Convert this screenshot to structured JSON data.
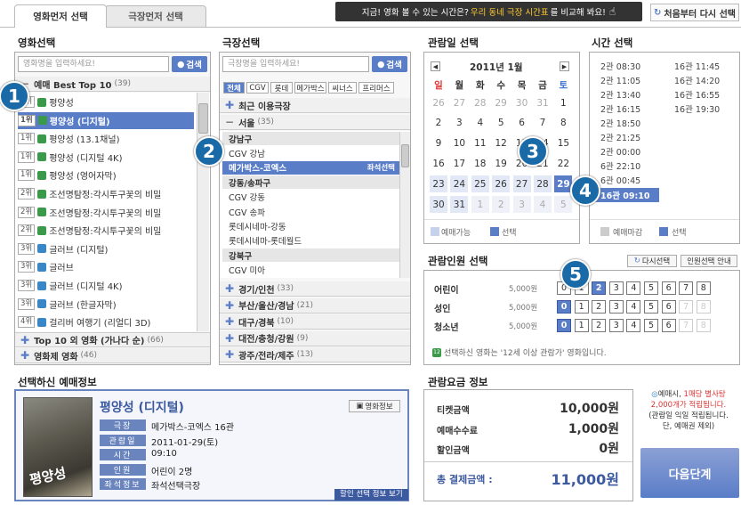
{
  "tabs": {
    "movie_first": "영화먼저 선택",
    "theater_first": "극장먼저 선택"
  },
  "promo": {
    "part1": "지금! 영화 볼 수 있는 시간은?",
    "highlight": "우리 동네 극장 시간표",
    "part2": "를 비교해 봐요!"
  },
  "reset_label": "처음부터 다시 선택",
  "movie": {
    "title": "영화선택",
    "search_placeholder": "영화명을 입력하세요!",
    "search_btn": "검색",
    "group_top": "예매 Best Top 10",
    "group_top_count": "(39)",
    "items": [
      {
        "rank": "1위",
        "name": "평양성"
      },
      {
        "rank": "1위",
        "name": "평양성 (디지털)"
      },
      {
        "rank": "1위",
        "name": "평양성 (13.1채널)"
      },
      {
        "rank": "1위",
        "name": "평양성 (디지털 4K)"
      },
      {
        "rank": "1위",
        "name": "평양성 (영어자막)"
      },
      {
        "rank": "2위",
        "name": "조선명탐정:각시투구꽃의 비밀"
      },
      {
        "rank": "2위",
        "name": "조선명탐정:각시투구꽃의 비밀"
      },
      {
        "rank": "2위",
        "name": "조선명탐정:각시투구꽃의 비밀"
      },
      {
        "rank": "3위",
        "name": "글러브 (디지털)"
      },
      {
        "rank": "3위",
        "name": "글러브"
      },
      {
        "rank": "3위",
        "name": "글러브 (디지털 4K)"
      },
      {
        "rank": "3위",
        "name": "글러브 (한글자막)"
      },
      {
        "rank": "4위",
        "name": "걸리버 여행기 (리얼디 3D)"
      }
    ],
    "group_other": "Top 10 외 영화 (가나다 순)",
    "group_other_count": "(66)",
    "group_festival": "영화제 영화",
    "group_festival_count": "(46)"
  },
  "theater": {
    "title": "극장선택",
    "search_placeholder": "극장명을 입력하세요!",
    "search_btn": "검색",
    "chains": [
      "전체",
      "CGV",
      "롯데",
      "메가박스",
      "씨너스",
      "프리머스"
    ],
    "recent": "최근 이용극장",
    "seoul": "서울",
    "seoul_count": "(35)",
    "rows": [
      {
        "text": "강남구",
        "type": "sub"
      },
      {
        "text": "CGV 강남",
        "type": "item"
      },
      {
        "text": "메가박스-코엑스",
        "type": "sel",
        "extra": "좌석선택"
      },
      {
        "text": "강동/송파구",
        "type": "sub"
      },
      {
        "text": "CGV 강동",
        "type": "item"
      },
      {
        "text": "CGV 송파",
        "type": "item"
      },
      {
        "text": "롯데시네마-강동",
        "type": "item"
      },
      {
        "text": "롯데시네마-롯데월드",
        "type": "item"
      },
      {
        "text": "강북구",
        "type": "sub"
      },
      {
        "text": "CGV 미아",
        "type": "item"
      }
    ],
    "regions": [
      {
        "name": "경기/인천",
        "count": "(33)"
      },
      {
        "name": "부산/울산/경남",
        "count": "(21)"
      },
      {
        "name": "대구/경북",
        "count": "(10)"
      },
      {
        "name": "대전/충청/강원",
        "count": "(9)"
      },
      {
        "name": "광주/전라/제주",
        "count": "(13)"
      }
    ]
  },
  "calendar": {
    "title": "관람일 선택",
    "month": "2011년 1월",
    "weekdays": [
      "일",
      "월",
      "화",
      "수",
      "목",
      "금",
      "토"
    ],
    "weeks": [
      [
        "26",
        "27",
        "28",
        "29",
        "30",
        "31",
        "1"
      ],
      [
        "2",
        "3",
        "4",
        "5",
        "6",
        "7",
        "8"
      ],
      [
        "9",
        "10",
        "11",
        "12",
        "13",
        "14",
        "15"
      ],
      [
        "16",
        "17",
        "18",
        "19",
        "20",
        "21",
        "22"
      ],
      [
        "23",
        "24",
        "25",
        "26",
        "27",
        "28",
        "29"
      ],
      [
        "30",
        "31",
        "1",
        "2",
        "3",
        "4",
        "5"
      ]
    ],
    "legend_available": "예매가능",
    "legend_selected": "선택"
  },
  "time": {
    "title": "시간 선택",
    "col1": [
      "2관 08:30",
      "2관 11:05",
      "2관 13:40",
      "2관 16:15",
      "2관 18:50",
      "2관 21:25",
      "2관 00:00",
      "6관 22:10",
      "6관 00:45",
      "16관 09:10"
    ],
    "col2": [
      "16관 11:45",
      "16관 14:20",
      "16관 16:55",
      "16관 19:30"
    ],
    "legend_closed": "예매마감",
    "legend_selected": "선택"
  },
  "people": {
    "title": "관람인원 선택",
    "reselect_btn": "다시선택",
    "guide_btn": "인원선택 안내",
    "rows": [
      {
        "label": "어린이",
        "price": "5,000원"
      },
      {
        "label": "성인",
        "price": "5,000원"
      },
      {
        "label": "청소년",
        "price": "5,000원"
      }
    ],
    "numbers": [
      "0",
      "1",
      "2",
      "3",
      "4",
      "5",
      "6",
      "7",
      "8"
    ],
    "notice": "선택하신 영화는 '12세 이상 관람가' 영화입니다."
  },
  "booking_info": {
    "title": "선택하신 예매정보",
    "movie_name": "평양성 (디지털)",
    "info_btn": "영화정보",
    "fields": [
      {
        "label": "극장",
        "value": "메가박스-코엑스 16관"
      },
      {
        "label": "관람일",
        "value": "2011-01-29(토)"
      },
      {
        "label": "시간",
        "value": "09:10"
      },
      {
        "label": "인원",
        "value": "어린이 2명"
      },
      {
        "label": "좌석정보",
        "value": "좌석선택극장"
      }
    ],
    "discount_link": "할인 선택 정보 보기",
    "poster_text": "평양성"
  },
  "price": {
    "title": "관람요금 정보",
    "ticket_label": "티켓금액",
    "ticket_value": "10,000",
    "fee_label": "예매수수료",
    "fee_value": "1,000",
    "discount_label": "할인금액",
    "discount_value": "0",
    "unit": "원",
    "total_label": "총 결제금액 :",
    "total_value": "11,000"
  },
  "points": {
    "line1a": "예매시, ",
    "line1b": "1매당 별사탕",
    "line2": "2,000개가 적립됩니다.",
    "line3": "(관람일 익일 적립됩니다.",
    "line4": "단, 예매권 제외)"
  },
  "next_btn": "다음단계",
  "badges": [
    "1",
    "2",
    "3",
    "4",
    "5"
  ],
  "colors": {
    "accent": "#5a7dc8",
    "badge": "#1a6aa8",
    "sunday": "#d33",
    "saturday": "#3a6fd0"
  }
}
